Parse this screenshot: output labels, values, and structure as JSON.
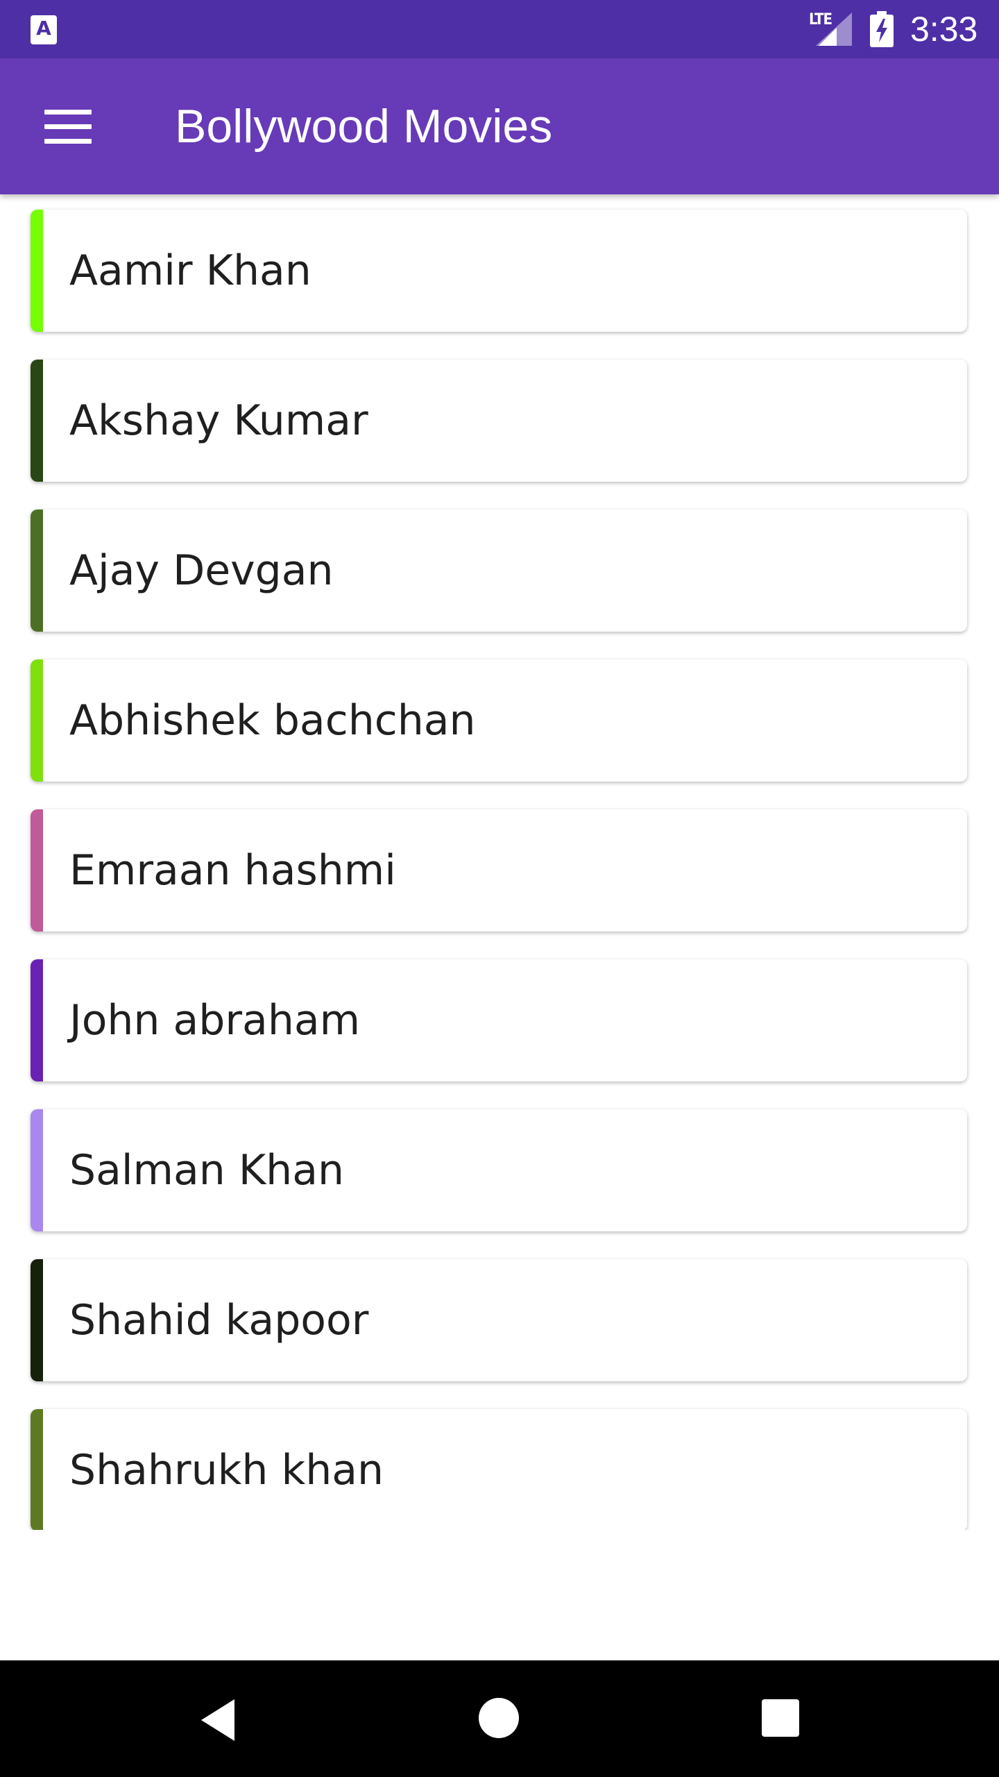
{
  "status_bar": {
    "app_icon_letter": "A",
    "network": "LTE",
    "time": "3:33",
    "icons": [
      "app-notification-icon",
      "signal-icon",
      "battery-charging-icon"
    ]
  },
  "app_bar": {
    "title": "Bollywood Movies",
    "menu_icon": "hamburger-menu-icon"
  },
  "actors": [
    {
      "name": "Aamir Khan",
      "color": "#76ff03"
    },
    {
      "name": "Akshay Kumar",
      "color": "#2a4614"
    },
    {
      "name": "Ajay Devgan",
      "color": "#4b7025"
    },
    {
      "name": "Abhishek bachchan",
      "color": "#7fe00b"
    },
    {
      "name": "Emraan hashmi",
      "color": "#c05a98"
    },
    {
      "name": "John abraham",
      "color": "#6a22b3"
    },
    {
      "name": "Salman Khan",
      "color": "#a887ef"
    },
    {
      "name": "Shahid kapoor",
      "color": "#17200b"
    },
    {
      "name": "Shahrukh khan",
      "color": "#5d7a22"
    }
  ],
  "nav_bar": {
    "icons": [
      "back-icon",
      "home-icon",
      "recents-icon"
    ]
  },
  "colors": {
    "status_bar": "#4e2fa6",
    "app_bar": "#673ab7"
  }
}
